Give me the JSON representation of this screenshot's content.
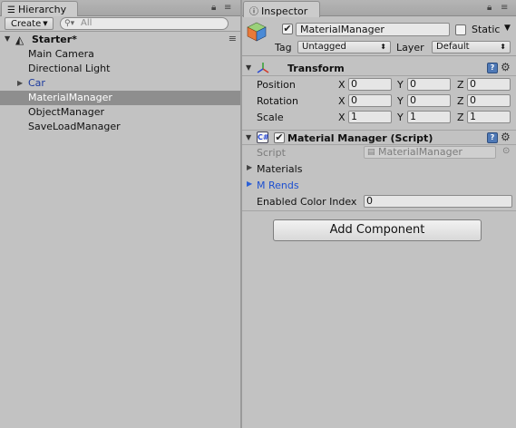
{
  "hierarchy": {
    "tab_label": "Hierarchy",
    "create_label": "Create",
    "search_placeholder": "All",
    "scene_name": "Starter*",
    "items": [
      {
        "label": "Main Camera",
        "kind": "normal"
      },
      {
        "label": "Directional Light",
        "kind": "normal"
      },
      {
        "label": "Car",
        "kind": "prefab-foldout"
      },
      {
        "label": "MaterialManager",
        "kind": "selected"
      },
      {
        "label": "ObjectManager",
        "kind": "normal"
      },
      {
        "label": "SaveLoadManager",
        "kind": "normal"
      }
    ]
  },
  "inspector": {
    "tab_label": "Inspector",
    "object_name": "MaterialManager",
    "static_label": "Static",
    "tag_label": "Tag",
    "tag_value": "Untagged",
    "layer_label": "Layer",
    "layer_value": "Default",
    "transform": {
      "title": "Transform",
      "rows": [
        {
          "label": "Position",
          "x": "0",
          "y": "0",
          "z": "0"
        },
        {
          "label": "Rotation",
          "x": "0",
          "y": "0",
          "z": "0"
        },
        {
          "label": "Scale",
          "x": "1",
          "y": "1",
          "z": "1"
        }
      ],
      "axis_x": "X",
      "axis_y": "Y",
      "axis_z": "Z"
    },
    "script_component": {
      "title": "Material Manager (Script)",
      "script_label": "Script",
      "script_value": "MaterialManager",
      "materials_label": "Materials",
      "mrends_label": "M Rends",
      "color_index_label": "Enabled Color Index",
      "color_index_value": "0"
    },
    "add_component_label": "Add Component"
  },
  "colors": {
    "panel_bg": "#c2c2c2",
    "selection": "#8e8e8e",
    "prefab_text": "#1c3a9e",
    "help_icon": "#4f79b6"
  }
}
